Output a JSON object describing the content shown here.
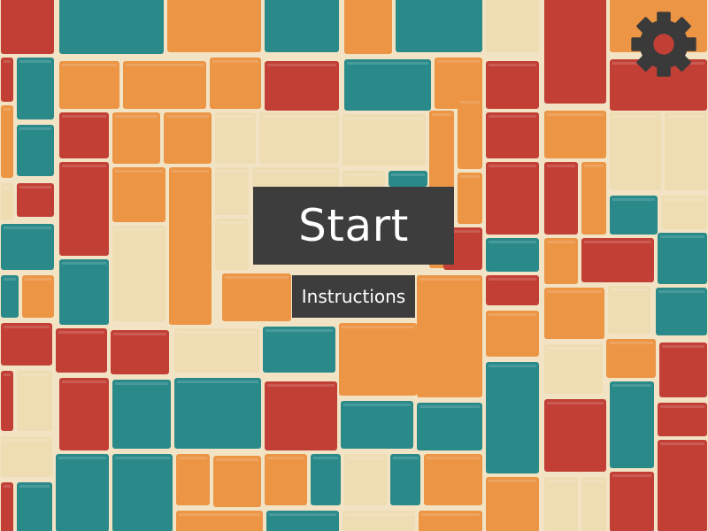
{
  "menu": {
    "start_label": "Start",
    "instructions_label": "Instructions"
  },
  "settings": {
    "icon": "gear-icon",
    "color": "#3a3a3a"
  },
  "background": {
    "pattern": "tile-mosaic",
    "colors": {
      "red": "#c23f36",
      "teal": "#2a8a8a",
      "orange": "#eb9545",
      "cream": "#eedcb2",
      "grout": "#f2e3c4"
    }
  }
}
